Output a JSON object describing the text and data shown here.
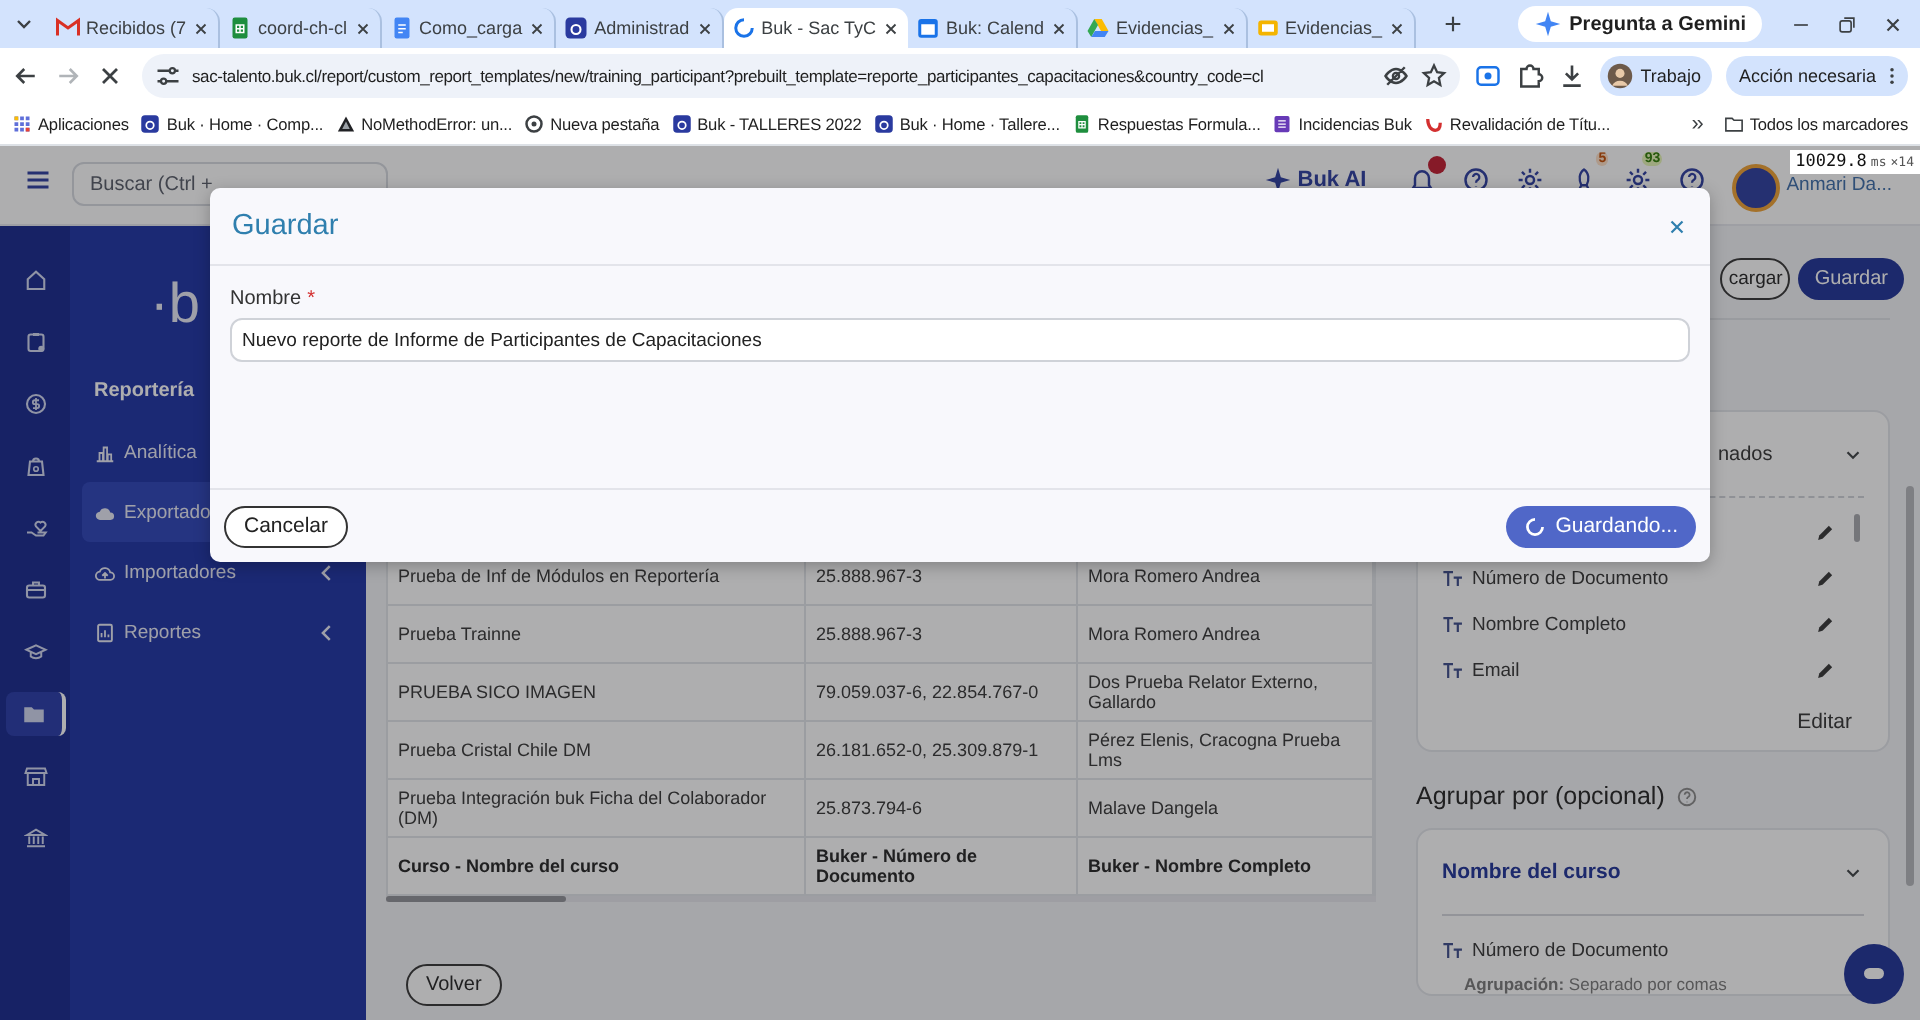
{
  "browser": {
    "tabs": [
      {
        "title": "Recibidos (7",
        "selected": false,
        "loading": false
      },
      {
        "title": "coord-ch-cl",
        "selected": false,
        "loading": false
      },
      {
        "title": "Como_carga",
        "selected": false,
        "loading": false
      },
      {
        "title": "Administrad",
        "selected": false,
        "loading": false
      },
      {
        "title": "Buk - Sac TyC",
        "selected": true,
        "loading": true
      },
      {
        "title": "Buk: Calend",
        "selected": false,
        "loading": false
      },
      {
        "title": "Evidencias_",
        "selected": false,
        "loading": false
      },
      {
        "title": "Evidencias_",
        "selected": false,
        "loading": false
      }
    ],
    "new_tab": "+",
    "gemini_button": "Pregunta a Gemini",
    "url": "sac-talento.buk.cl/report/custom_report_templates/new/training_participant?prebuilt_template=reporte_participantes_capacitaciones&country_code=cl",
    "profile": "Trabajo",
    "action_button": "Acción necesaria",
    "bookmarks": [
      "Aplicaciones",
      "Buk · Home · Comp...",
      "NoMethodError: un...",
      "Nueva pestaña",
      "Buk - TALLERES 2022",
      "Buk · Home · Tallere...",
      "Respuestas Formula...",
      "Incidencias Buk",
      "Revalidación de Títu..."
    ],
    "more_bookmarks": "»",
    "all_bookmarks": "Todos los marcadores"
  },
  "debug_overlay": {
    "value": "10029.8",
    "unit": "ms",
    "count": "×14"
  },
  "header": {
    "search_placeholder": "Buscar (Ctrl +",
    "ai_label": "Buk AI",
    "badges": [
      "5",
      "93"
    ],
    "user": "Anmari Da..."
  },
  "rail": [
    {
      "selected": false
    },
    {
      "selected": false
    },
    {
      "selected": false
    },
    {
      "selected": false
    },
    {
      "selected": false
    },
    {
      "selected": false
    },
    {
      "selected": false
    },
    {
      "selected": true
    },
    {
      "selected": false
    },
    {
      "selected": false
    }
  ],
  "sidebar": {
    "logo": "·b",
    "section": "Reportería",
    "items": [
      {
        "label": "Analítica",
        "selected": false
      },
      {
        "label": "Exportado",
        "selected": true
      },
      {
        "label": "Importadores",
        "selected": false,
        "expandable": true
      },
      {
        "label": "Reportes",
        "selected": false,
        "expandable": true
      }
    ]
  },
  "table": {
    "rows": [
      [
        "Prueba de Inf de Módulos en Reportería",
        "25.888.967-3",
        "Mora Romero Andrea"
      ],
      [
        "Prueba Trainne",
        "25.888.967-3",
        "Mora Romero Andrea"
      ],
      [
        "PRUEBA SICO IMAGEN",
        "79.059.037-6, 22.854.767-0",
        "Dos Prueba Relator Externo, Gallardo"
      ],
      [
        "Prueba Cristal Chile DM",
        "26.181.652-0, 25.309.879-1",
        "Pérez Elenis, Cracogna Prueba Lms"
      ],
      [
        "Prueba Integración buk Ficha del Colaborador (DM)",
        "25.873.794-6",
        "Malave Dangela"
      ]
    ],
    "column_headers": [
      "Curso - Nombre del curso",
      "Buker - Número de Documento",
      "Buker - Nombre Completo"
    ]
  },
  "back_button": "Volver",
  "actions": [
    {
      "label": "cargar",
      "kind": "outline"
    },
    {
      "label": "Guardar",
      "kind": "primary"
    }
  ],
  "fields_card": {
    "title": "nados",
    "fields": [
      "Número de Documento",
      "Nombre Completo",
      "Email"
    ],
    "edit_link": "Editar"
  },
  "group_by": {
    "title": "Agrupar por (opcional)",
    "card_title": "Nombre del curso",
    "fields": [
      {
        "label": "Número de Documento",
        "note": "**Agrupación:** Separado por comas"
      }
    ]
  },
  "modal": {
    "title": "Guardar",
    "field_label": "Nombre",
    "required_mark": "*",
    "value": "Nuevo reporte de Informe de Participantes de Capacitaciones",
    "cancel": "Cancelar",
    "submit": "Guardando...",
    "loading": true
  }
}
